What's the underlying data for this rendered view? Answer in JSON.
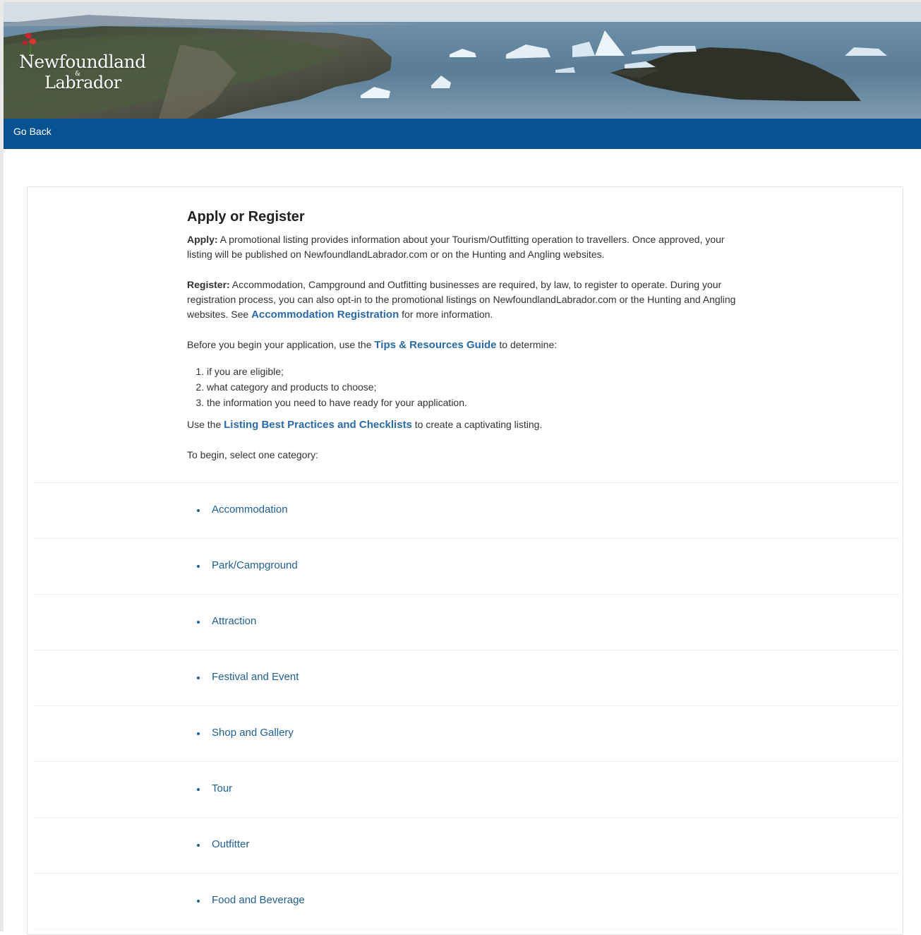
{
  "header": {
    "logo_line1": "Newfoundland",
    "logo_amp": "&",
    "logo_line2": "Labrador"
  },
  "nav": {
    "go_back": "Go Back"
  },
  "main": {
    "title": "Apply or Register",
    "apply_label": "Apply:",
    "apply_text": " A promotional listing provides information about your Tourism/Outfitting operation to travellers. Once approved, your listing will be published on NewfoundlandLabrador.com or on the Hunting and Angling websites.",
    "register_label": "Register:",
    "register_text": " Accommodation, Campground and Outfitting businesses are required, by law, to register to operate. During your registration process, you can also opt-in to the promotional listings on NewfoundlandLabrador.com or the Hunting and Angling websites. See ",
    "register_link": "Accommodation Registration",
    "register_tail": " for more information.",
    "before_text": "Before you begin your application, use the ",
    "tips_link": "Tips & Resources Guide",
    "before_tail": " to determine:",
    "steps": [
      "if you are eligible;",
      "what category and products to choose;",
      "the information you need to have ready for your application."
    ],
    "use_text": "Use the ",
    "best_practices_link": "Listing Best Practices and Checklists",
    "use_tail": " to create a captivating listing.",
    "select_prompt": "To begin, select one category:"
  },
  "categories": [
    "Accommodation",
    "Park/Campground",
    "Attraction",
    "Festival and Event",
    "Shop and Gallery",
    "Tour",
    "Outfitter",
    "Food and Beverage"
  ],
  "colors": {
    "nav_bg": "#095291",
    "link": "#2a6aa6",
    "category_link": "#1f5f94"
  }
}
